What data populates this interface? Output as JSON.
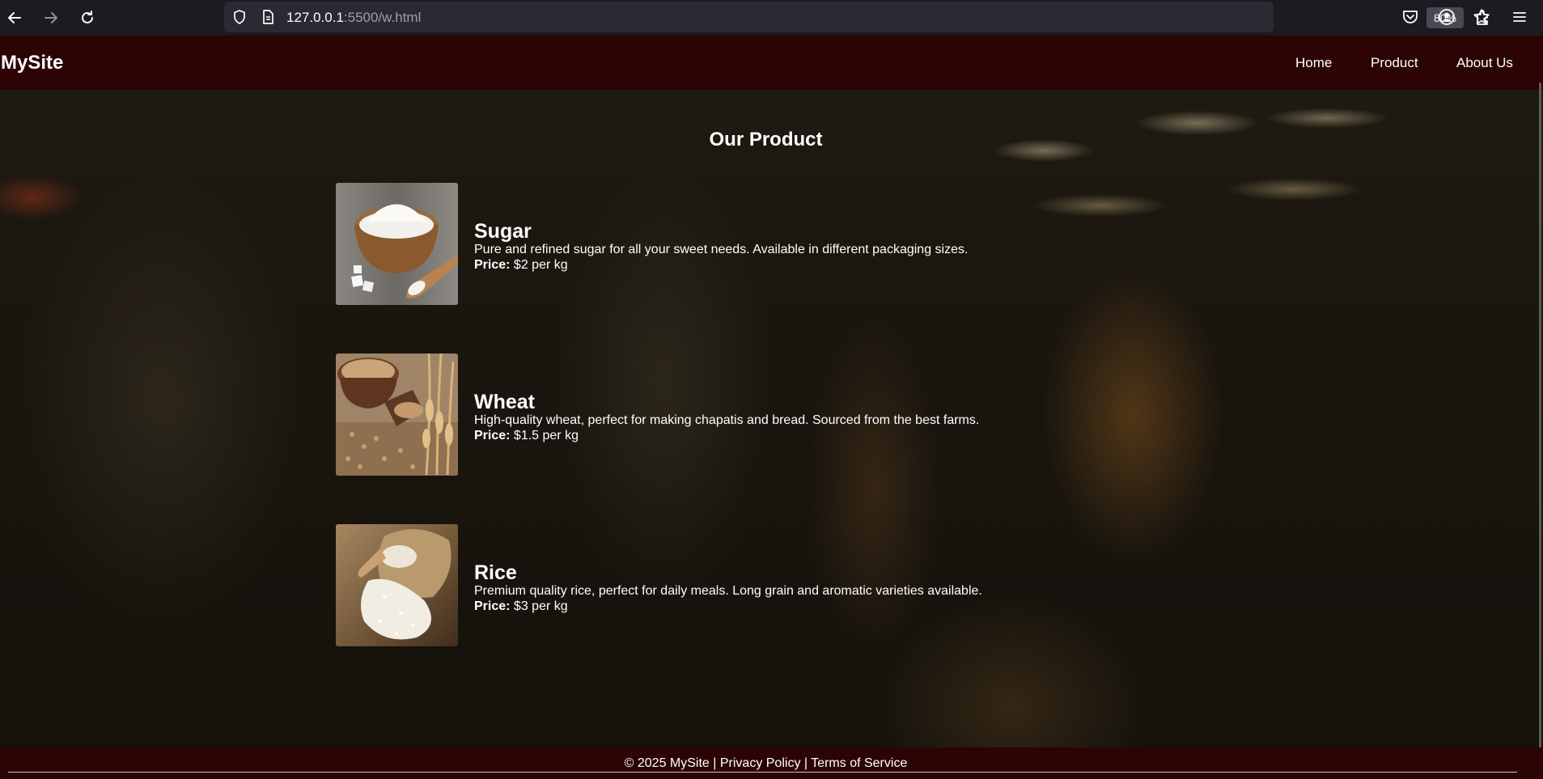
{
  "browser": {
    "url_host": "127.0.0.1",
    "url_rest": ":5500/w.html",
    "zoom": "80%",
    "icons": [
      "back-icon",
      "forward-icon",
      "reload-icon",
      "shield-icon",
      "page-icon",
      "star-icon",
      "pocket-icon",
      "account-icon",
      "extensions-icon",
      "menu-icon"
    ]
  },
  "header": {
    "logo": "MySite",
    "nav": [
      "Home",
      "Product",
      "About Us"
    ],
    "background": "#2c0404"
  },
  "main": {
    "title": "Our Product",
    "products": [
      {
        "name": "Sugar",
        "description": "Pure and refined sugar for all your sweet needs. Available in different packaging sizes.",
        "price_label": "Price:",
        "price": "$2 per kg",
        "image": "sugar-bowl-image"
      },
      {
        "name": "Wheat",
        "description": "High-quality wheat, perfect for making chapatis and bread. Sourced from the best farms.",
        "price_label": "Price:",
        "price": "$1.5 per kg",
        "image": "wheat-bowl-image"
      },
      {
        "name": "Rice",
        "description": "Premium quality rice, perfect for daily meals. Long grain and aromatic varieties available.",
        "price_label": "Price:",
        "price": "$3 per kg",
        "image": "rice-sack-image"
      }
    ]
  },
  "footer": {
    "text": "© 2025 MySite | Privacy Policy | Terms of Service"
  }
}
